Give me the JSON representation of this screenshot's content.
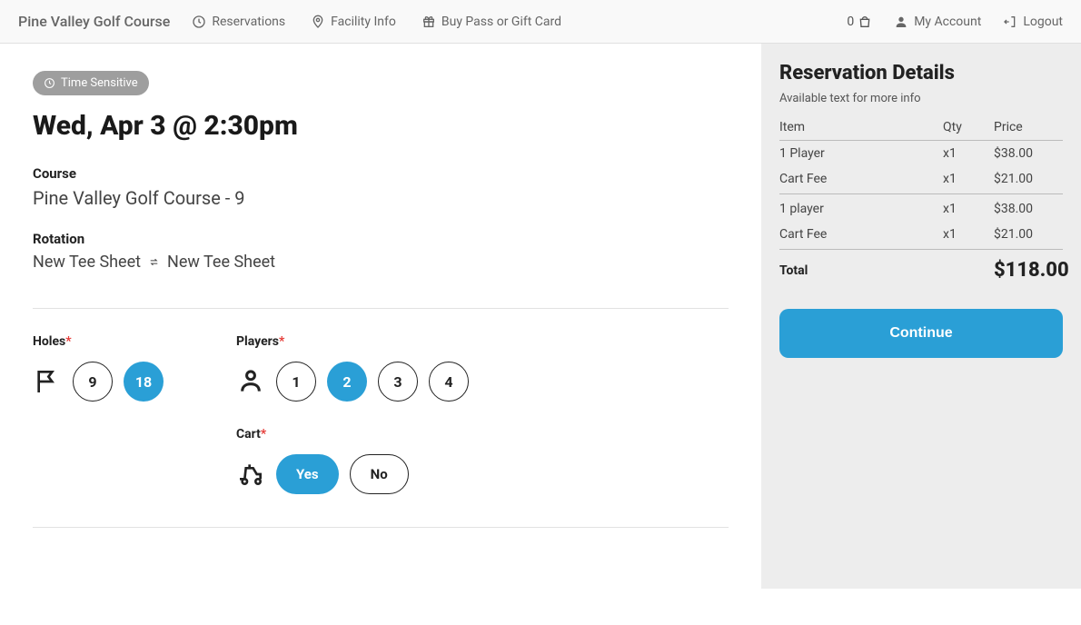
{
  "header": {
    "brand": "Pine Valley Golf Course",
    "nav": {
      "reservations": "Reservations",
      "facility": "Facility Info",
      "buy": "Buy Pass or Gift Card"
    },
    "cart_count": "0",
    "account": "My Account",
    "logout": "Logout"
  },
  "booking": {
    "badge": "Time Sensitive",
    "datetime": "Wed, Apr 3 @ 2:30pm",
    "course_label": "Course",
    "course_value": "Pine Valley Golf Course - 9",
    "rotation_label": "Rotation",
    "rotation_a": "New Tee Sheet",
    "rotation_b": "New Tee Sheet"
  },
  "holes": {
    "label": "Holes",
    "options": {
      "a": "9",
      "b": "18"
    },
    "selected": "18"
  },
  "players": {
    "label": "Players",
    "options": {
      "a": "1",
      "b": "2",
      "c": "3",
      "d": "4"
    },
    "selected": "2"
  },
  "cart": {
    "label": "Cart",
    "options": {
      "yes": "Yes",
      "no": "No"
    },
    "selected": "Yes"
  },
  "sidebar": {
    "title": "Reservation Details",
    "subtitle": "Available text for more info",
    "cols": {
      "item": "Item",
      "qty": "Qty",
      "price": "Price"
    },
    "rows": [
      {
        "item": "1 Player",
        "qty": "x1",
        "price": "$38.00"
      },
      {
        "item": "Cart Fee",
        "qty": "x1",
        "price": "$21.00"
      },
      {
        "item": "1 player",
        "qty": "x1",
        "price": "$38.00"
      },
      {
        "item": "Cart Fee",
        "qty": "x1",
        "price": "$21.00"
      }
    ],
    "total_label": "Total",
    "total_amount": "$118.00",
    "continue": "Continue"
  }
}
